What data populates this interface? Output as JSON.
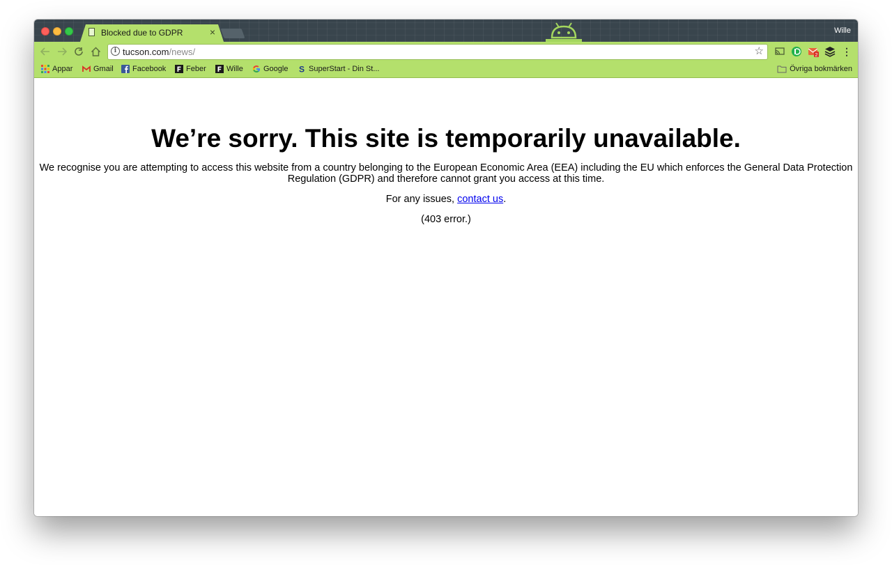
{
  "browser": {
    "tab_title": "Blocked due to GDPR",
    "profile_name": "Wille",
    "url_host": "tucson.com",
    "url_path": "/news/",
    "theme_color": "#b4e06c",
    "titlebar_color": "#39454d",
    "extension_badge": "2"
  },
  "bookmarks": {
    "items": [
      {
        "label": "Appar",
        "icon": "apps-grid-icon"
      },
      {
        "label": "Gmail",
        "icon": "gmail-icon"
      },
      {
        "label": "Facebook",
        "icon": "facebook-icon"
      },
      {
        "label": "Feber",
        "icon": "feber-icon"
      },
      {
        "label": "Wille",
        "icon": "feber-icon"
      },
      {
        "label": "Google",
        "icon": "google-icon"
      },
      {
        "label": "SuperStart - Din St...",
        "icon": "superstart-icon"
      }
    ],
    "other": "Övriga bokmärken"
  },
  "page": {
    "heading": "We’re sorry. This site is temporarily unavailable.",
    "message_line1": "We recognise you are attempting to access this website from a country belonging to the European Economic Area (EEA) including the EU which enforces the General Data Protection",
    "message_line2": "Regulation (GDPR) and therefore cannot grant you access at this time.",
    "contact_prefix": "For any issues, ",
    "contact_link": "contact us",
    "contact_suffix": ".",
    "error_code": "(403 error.)"
  }
}
